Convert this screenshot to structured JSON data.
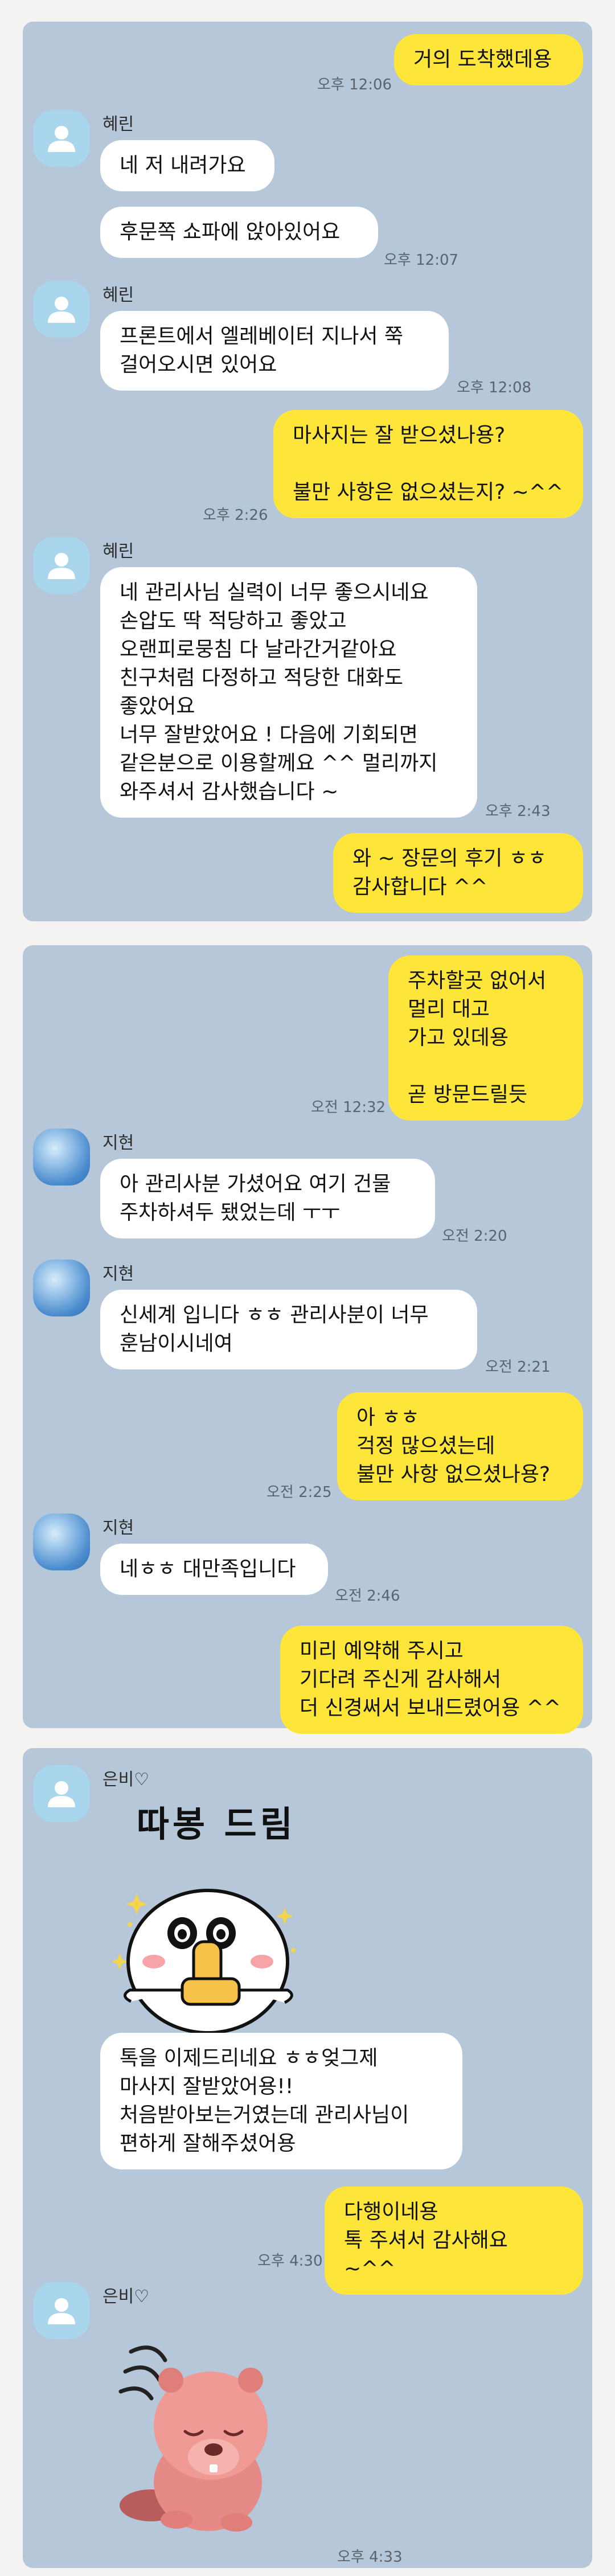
{
  "panels": [
    {
      "messages": [
        {
          "text": "거의 도착했데용",
          "time": "오후 12:06"
        },
        {
          "name": "혜린",
          "text": "네 저 내려가요"
        },
        {
          "text": "후문쪽 쇼파에 앉아있어요",
          "time": "오후 12:07"
        },
        {
          "name": "혜린",
          "text": "프론트에서 엘레베이터 지나서 쭉\n걸어오시면 있어요",
          "time": "오후 12:08"
        },
        {
          "text": "마사지는 잘 받으셨나용?\n\n불만 사항은 없으셨는지? ~^^",
          "time": "오후 2:26"
        },
        {
          "name": "혜린",
          "text": "네 관리사님 실력이 너무 좋으시네요\n손압도 딱 적당하고 좋았고\n오랜피로뭉침 다 날라간거같아요\n친구처럼 다정하고 적당한 대화도\n좋았어요\n너무 잘받았어요 ! 다음에 기회되면\n같은분으로 이용할께요 ^^ 멀리까지\n와주셔서 감사했습니다 ~",
          "time": "오후 2:43"
        },
        {
          "text": "와 ~ 장문의 후기 ㅎㅎ\n감사합니다 ^^"
        }
      ]
    },
    {
      "messages": [
        {
          "text": "주차할곳 없어서\n멀리 대고\n가고 있데용\n\n곧 방문드릴듯",
          "time": "오전 12:32"
        },
        {
          "name": "지현",
          "text": "아 관리사분 가셨어요 여기 건물\n주차하셔두 됐었는데 ㅜㅜ",
          "time": "오전 2:20"
        },
        {
          "name": "지현",
          "text": "신세계 입니다 ㅎㅎ 관리사분이 너무\n훈남이시네여",
          "time": "오전 2:21"
        },
        {
          "text": "아 ㅎㅎ\n걱정 많으셨는데\n불만 사항 없으셨나용?",
          "time": "오전 2:25"
        },
        {
          "name": "지현",
          "text": "네ㅎㅎ 대만족입니다",
          "time": "오전 2:46"
        },
        {
          "text": "미리 예약해 주시고\n기다려 주신게 감사해서\n더 신경써서 보내드렸어용 ^^"
        }
      ]
    },
    {
      "messages": [
        {
          "name": "은비♡",
          "sticker_text": "따봉 드림"
        },
        {
          "text": "톡을 이제드리네요 ㅎㅎ엊그제\n마사지 잘받았어용!!\n처음받아보는거였는데 관리사님이\n편하게 잘해주셨어용"
        },
        {
          "text": "다행이네용\n톡 주셔서 감사해요 ~^^",
          "time": "오후 4:30"
        },
        {
          "name": "은비♡",
          "time": "오후 4:33"
        }
      ]
    }
  ],
  "colors": {
    "panel_bg": "#b5c7d8",
    "my_bubble": "#fde53a",
    "their_bubble": "#ffffff",
    "page_bg": "#f4f3f1"
  },
  "icons": [
    "person-silhouette-icon",
    "thumbs-up-sticker",
    "loopy-beaver-sticker"
  ]
}
